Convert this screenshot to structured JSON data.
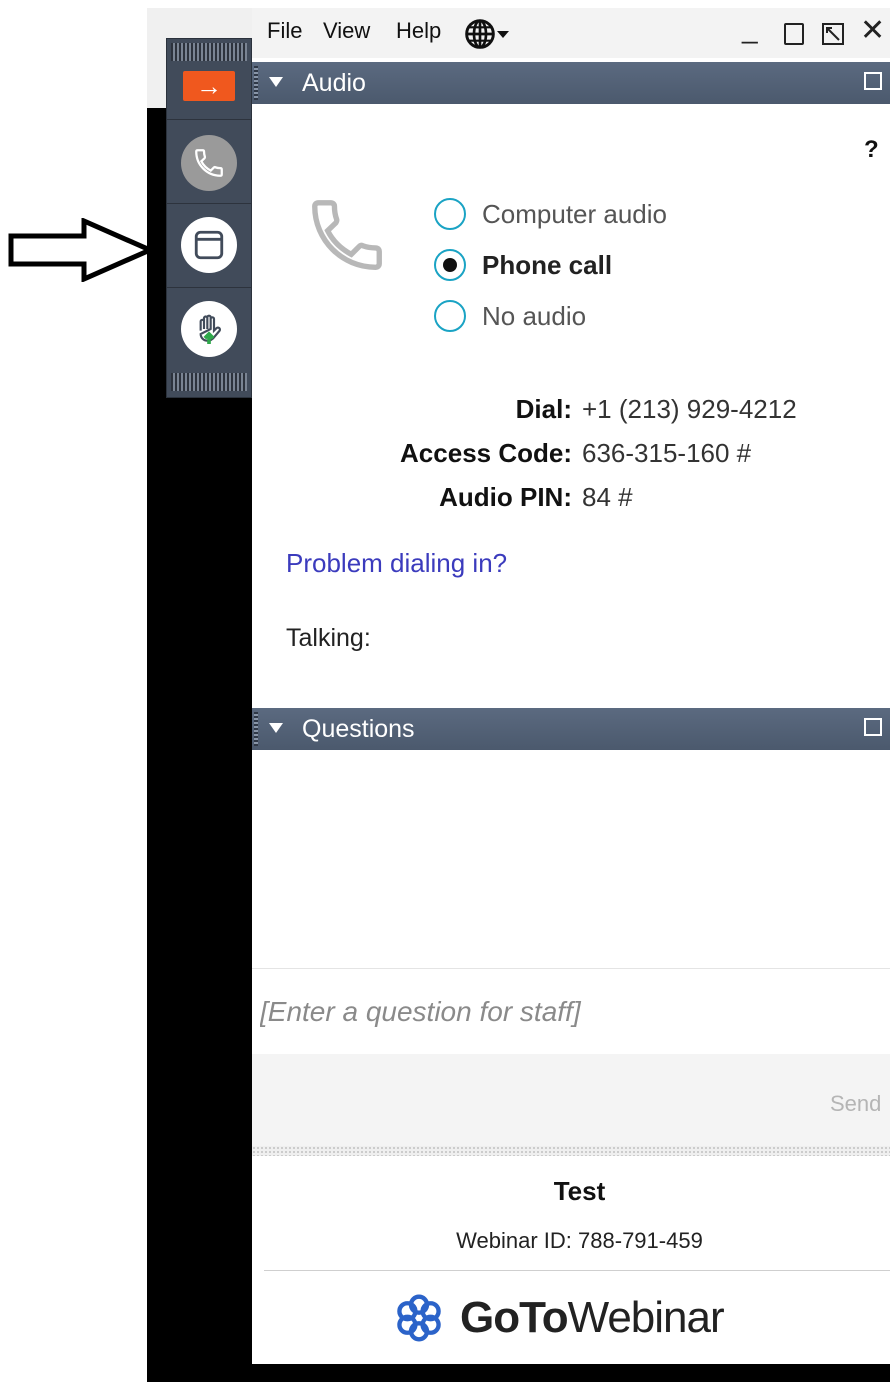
{
  "menu": {
    "file": "File",
    "view": "View",
    "help": "Help"
  },
  "window_controls": {
    "minimize": "_",
    "close": "✕"
  },
  "toolbar": {
    "collapse_glyph": "→"
  },
  "audio_panel": {
    "title": "Audio",
    "help": "?",
    "options": [
      {
        "label": "Computer audio",
        "selected": false
      },
      {
        "label": "Phone call",
        "selected": true
      },
      {
        "label": "No audio",
        "selected": false
      }
    ],
    "dial_label": "Dial:",
    "dial_value": "+1 (213) 929-4212",
    "access_label": "Access Code:",
    "access_value": "636-315-160 #",
    "pin_label": "Audio PIN:",
    "pin_value": "84 #",
    "problem_link": "Problem dialing in?",
    "talking_label": "Talking:"
  },
  "questions_panel": {
    "title": "Questions",
    "input_placeholder": "[Enter a question for staff]",
    "send_label": "Send"
  },
  "footer": {
    "webinar_title": "Test",
    "webinar_id": "Webinar ID: 788-791-459",
    "brand_goto": "GoTo",
    "brand_webinar": "Webinar"
  },
  "colors": {
    "panel_header": "#4f5d72",
    "radio_ring": "#1aa3c4",
    "link": "#3b3bbd",
    "orange": "#f0581e",
    "brand_icon": "#2b63c9"
  }
}
